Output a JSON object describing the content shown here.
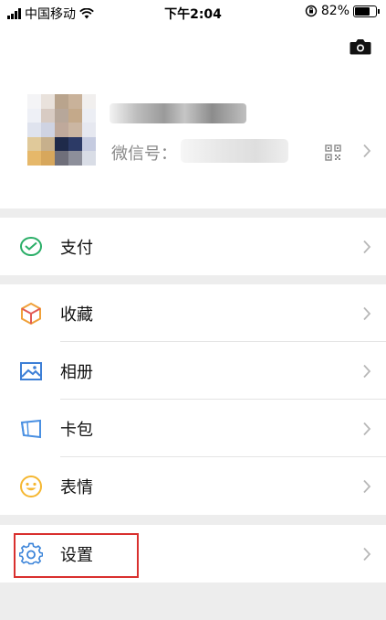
{
  "status_bar": {
    "carrier": "中国移动",
    "time": "下午2:04",
    "battery_percent": "82%",
    "battery_level": 0.82
  },
  "profile": {
    "wechat_id_label": "微信号："
  },
  "menu": {
    "pay": "支付",
    "favorites": "收藏",
    "album": "相册",
    "cards": "卡包",
    "stickers": "表情",
    "settings": "设置"
  },
  "colors": {
    "pay_green": "#2aae67",
    "favorites_orange": "#f0a13a",
    "album_blue": "#3d7fd6",
    "cards_blue": "#4a90e2",
    "stickers_yellow": "#f5b731",
    "settings_blue": "#3b84d9",
    "highlight_red": "#d9302e"
  },
  "icons": {
    "camera": "camera-icon",
    "qr": "qr-code-icon",
    "chevron": "chevron-right-icon",
    "pay": "wallet-icon",
    "favorites": "cube-icon",
    "album": "image-icon",
    "cards": "card-icon",
    "stickers": "smile-icon",
    "settings": "gear-icon"
  }
}
